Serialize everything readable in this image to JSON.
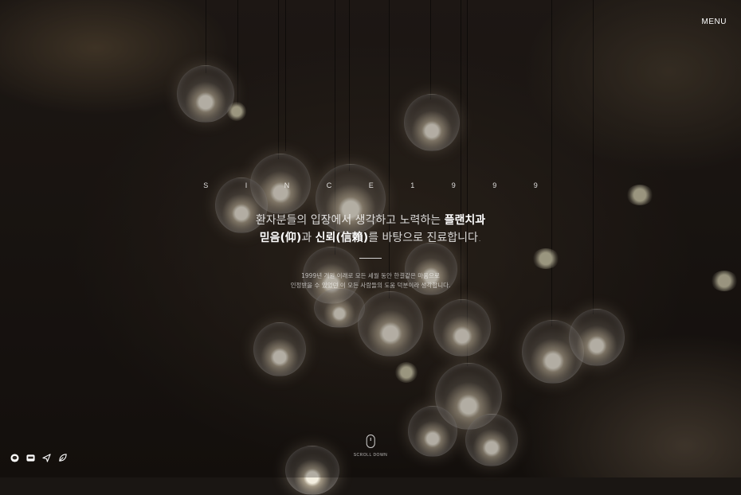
{
  "header": {
    "menu_label": "MENU"
  },
  "hero": {
    "since": "S I N C E   1 9 9 9",
    "headline_line1_a": "환자분들의 입장에서 생각하고 노력하는 ",
    "headline_line1_b": "플랜치과",
    "headline_line2_a": "믿음(仰)",
    "headline_line2_b": "과 ",
    "headline_line2_c": "신뢰(信賴)",
    "headline_line2_d": "를 바탕으로 진료합니다.",
    "desc_line1": "1999년 개원 이래로 모든 세월 동안 한결같은 마음으로",
    "desc_line2": "인정받을 수 있었던 이 모든 사람들의 도움 덕분이라 생각합니다."
  },
  "scroll": {
    "label": "SCROLL DOWN"
  },
  "social": [
    {
      "icon": "kakao-talk-icon"
    },
    {
      "icon": "naver-blog-icon"
    },
    {
      "icon": "send-icon"
    },
    {
      "icon": "leaf-icon"
    }
  ]
}
